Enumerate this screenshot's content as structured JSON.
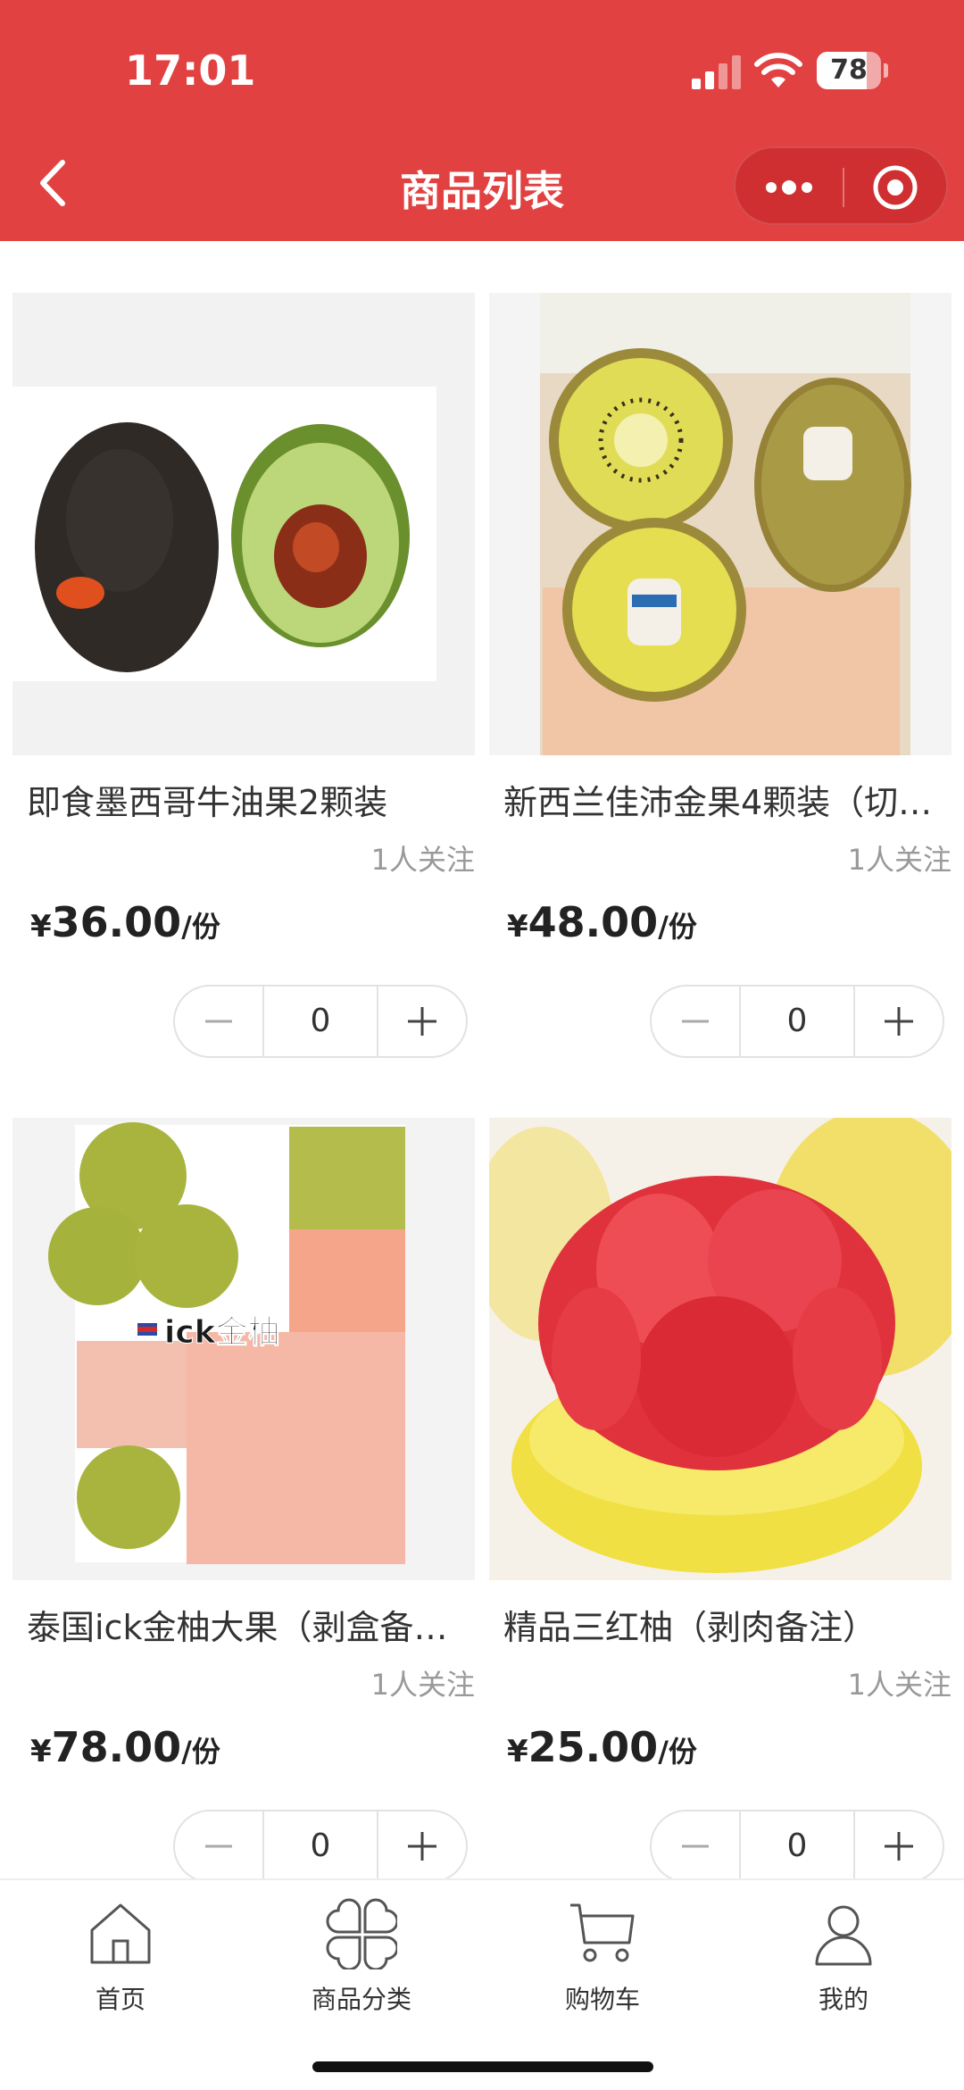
{
  "status_bar": {
    "time": "17:01",
    "battery": "78",
    "battery_level": 0.78
  },
  "nav": {
    "title": "商品列表"
  },
  "products": [
    {
      "name": "即食墨西哥牛油果2颗装",
      "followers": "1人关注",
      "currency": "¥",
      "price": "36.00",
      "unit": "/份",
      "quantity": "0",
      "image_icon": "avocado-image"
    },
    {
      "name": "新西兰佳沛金果4颗装（切…",
      "followers": "1人关注",
      "currency": "¥",
      "price": "48.00",
      "unit": "/份",
      "quantity": "0",
      "image_icon": "kiwi-image"
    },
    {
      "name": "泰国ick金柚大果（剥盒备…",
      "followers": "1人关注",
      "currency": "¥",
      "price": "78.00",
      "unit": "/份",
      "quantity": "0",
      "image_icon": "pomelo-image",
      "image_caption": "ick金柚"
    },
    {
      "name": "精品三红柚（剥肉备注）",
      "followers": "1人关注",
      "currency": "¥",
      "price": "25.00",
      "unit": "/份",
      "quantity": "0",
      "image_icon": "red-pomelo-image"
    }
  ],
  "tabbar": {
    "items": [
      {
        "label": "首页",
        "icon": "home-icon"
      },
      {
        "label": "商品分类",
        "icon": "category-icon"
      },
      {
        "label": "购物车",
        "icon": "cart-icon"
      },
      {
        "label": "我的",
        "icon": "profile-icon"
      }
    ]
  },
  "colors": {
    "brand": "#e24141",
    "capsule": "#cf2f31",
    "muted_text": "#999999"
  }
}
